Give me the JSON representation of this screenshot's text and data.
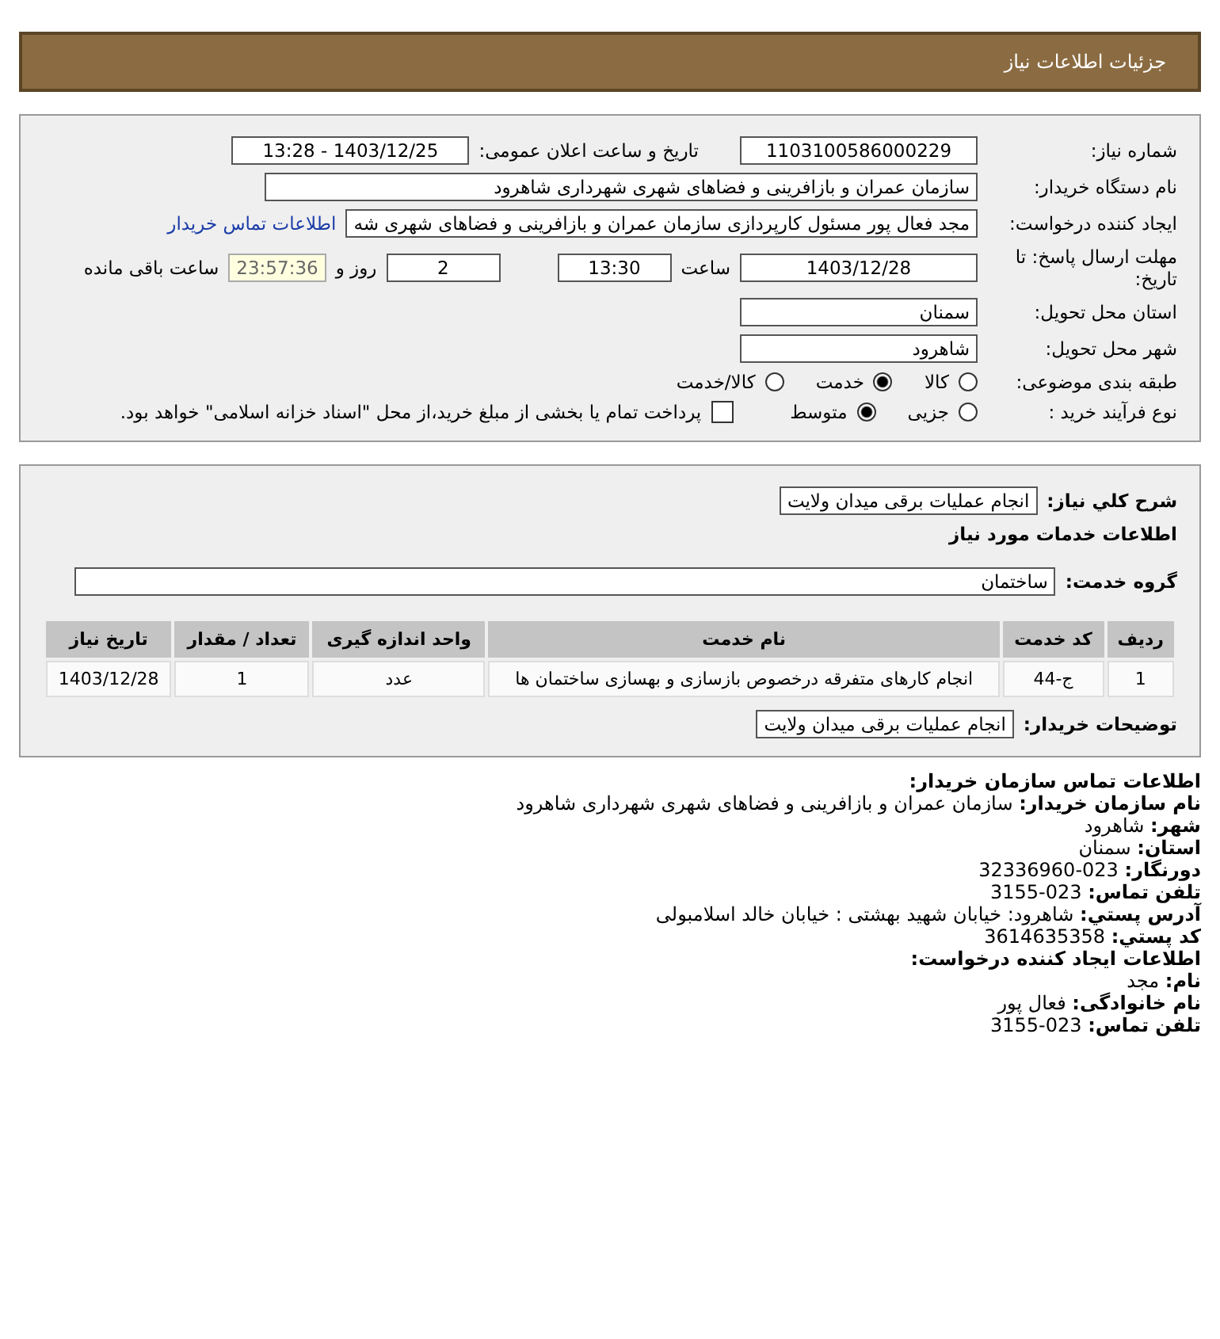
{
  "header": {
    "title": "جزئیات اطلاعات نیاز"
  },
  "details": {
    "need_number": {
      "label": "شماره نیاز:",
      "value": "1103100586000229"
    },
    "announce": {
      "label": "تاریخ و ساعت اعلان عمومی:",
      "value": "1403/12/25 - 13:28"
    },
    "buyer": {
      "label": "نام دستگاه خریدار:",
      "value": "سازمان عمران و بازافرینی و فضاهای شهری شهرداری شاهرود"
    },
    "requester": {
      "label": "ایجاد کننده درخواست:",
      "value": "مجد فعال پور مسئول کارپردازی سازمان عمران و بازافرینی و فضاهای شهری شه",
      "link": "اطلاعات تماس خریدار"
    },
    "deadline": {
      "label": "مهلت ارسال پاسخ: تا تاریخ:",
      "date": "1403/12/28",
      "time_label": "ساعت",
      "time": "13:30",
      "days": "2",
      "days_label": "روز و",
      "remaining": "23:57:36",
      "remaining_label": "ساعت باقی مانده"
    },
    "province": {
      "label": "استان محل تحویل:",
      "value": "سمنان"
    },
    "city": {
      "label": "شهر محل تحویل:",
      "value": "شاهرود"
    },
    "category": {
      "label": "طبقه بندی موضوعی:",
      "options": [
        {
          "label": "کالا",
          "selected": false
        },
        {
          "label": "خدمت",
          "selected": true
        },
        {
          "label": "کالا/خدمت",
          "selected": false
        }
      ]
    },
    "process": {
      "label": "نوع فرآیند خرید :",
      "options": [
        {
          "label": "جزیی",
          "selected": false
        },
        {
          "label": "متوسط",
          "selected": true
        }
      ],
      "payment": {
        "checked": false,
        "text": "پرداخت تمام یا بخشی از مبلغ خرید،از محل \"اسناد خزانه اسلامی\" خواهد بود."
      }
    }
  },
  "summary": {
    "label": "شرح کلي نیاز:",
    "value": "انجام عملیات برقی میدان ولایت",
    "services_title": "اطلاعات خدمات مورد نیاز",
    "group_label": "گروه خدمت:",
    "group_value": "ساختمان",
    "table": {
      "columns": [
        "ردیف",
        "کد خدمت",
        "نام خدمت",
        "واحد اندازه گیری",
        "تعداد / مقدار",
        "تاریخ نیاز"
      ],
      "rows": [
        [
          "1",
          "ج-44",
          "انجام کارهای متفرقه درخصوص بازسازی و بهسازی ساختمان ها",
          "عدد",
          "1",
          "1403/12/28"
        ]
      ]
    },
    "notes_label": "توضیحات خریدار:",
    "notes_value": "انجام عملیات برقی میدان ولایت"
  },
  "contact": {
    "title": "اطلاعات تماس سازمان خریدار:",
    "lines": [
      {
        "label": "نام سازمان خریدار:",
        "value": "سازمان عمران و بازافرینی و فضاهای شهری شهرداری شاهرود"
      },
      {
        "label": "شهر:",
        "value": "شاهرود"
      },
      {
        "label": "استان:",
        "value": "سمنان"
      },
      {
        "label": "دورنگار:",
        "value": "023-32336960"
      },
      {
        "label": "تلفن تماس:",
        "value": "023-3155"
      },
      {
        "label": "آدرس پستي:",
        "value": "شاهرود: خیابان شهید بهشتی : خیابان خالد اسلامبولی"
      },
      {
        "label": "کد پستي:",
        "value": "3614635358"
      }
    ],
    "creator_title": "اطلاعات ایجاد کننده درخواست:",
    "creator_lines": [
      {
        "label": "نام:",
        "value": "مجد"
      },
      {
        "label": "نام خانوادگی:",
        "value": "فعال پور"
      },
      {
        "label": "تلفن تماس:",
        "value": "023-3155"
      }
    ]
  }
}
